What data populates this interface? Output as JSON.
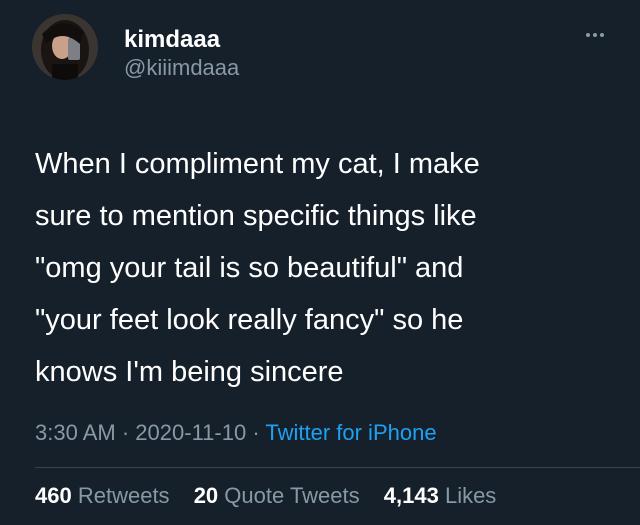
{
  "user": {
    "display_name": "kimdaaa",
    "handle": "@kiiimdaaa"
  },
  "tweet": {
    "lines": [
      "When I compliment my cat, I make",
      "sure to mention specific things like",
      "\"omg your tail is so beautiful\" and",
      "\"your feet look really fancy\" so he",
      "knows I'm being sincere"
    ]
  },
  "meta": {
    "time": "3:30 AM",
    "separator": "·",
    "date": "2020-11-10",
    "source": "Twitter for iPhone"
  },
  "stats": {
    "retweets": {
      "count": "460",
      "label": "Retweets"
    },
    "quote_tweets": {
      "count": "20",
      "label": "Quote Tweets"
    },
    "likes": {
      "count": "4,143",
      "label": "Likes"
    }
  },
  "icons": {
    "more": "more-horizontal-icon"
  },
  "colors": {
    "background": "#15202b",
    "secondary_text": "#8899a6",
    "link": "#1da1f2",
    "divider": "#38444d"
  }
}
